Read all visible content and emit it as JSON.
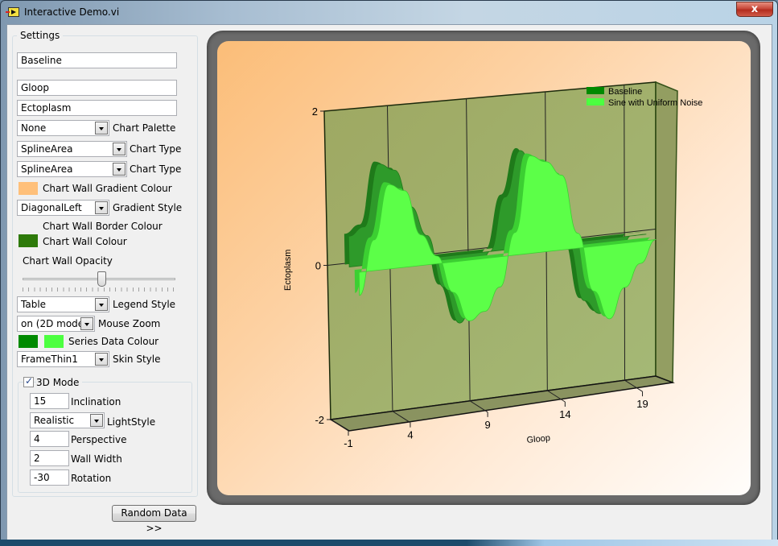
{
  "window": {
    "title": "Interactive Demo.vi",
    "close_label": "x"
  },
  "settings": {
    "group_title": "Settings",
    "series1_name": "Baseline",
    "x_axis_title": "Gloop",
    "y_axis_title": "Ectoplasm",
    "chart_palette": {
      "value": "None",
      "label": "Chart Palette"
    },
    "chart_type_1": {
      "value": "SplineArea",
      "label": "Chart Type"
    },
    "chart_type_2": {
      "value": "SplineArea",
      "label": "Chart Type"
    },
    "wall_gradient_colour": {
      "label": "Chart Wall Gradient Colour",
      "color": "#ffc07a"
    },
    "gradient_style": {
      "value": "DiagonalLeft",
      "label": "Gradient Style"
    },
    "wall_border_colour": {
      "label": "Chart Wall Border Colour"
    },
    "wall_colour": {
      "label": "Chart Wall Colour",
      "color": "#2e7a0a"
    },
    "wall_opacity": {
      "label": "Chart Wall Opacity",
      "value_fraction": 0.5
    },
    "legend_style": {
      "value": "Table",
      "label": "Legend Style"
    },
    "mouse_zoom": {
      "value": "on (2D mode",
      "label": "Mouse Zoom"
    },
    "series_colour": {
      "label": "Series Data Colour",
      "color1": "#008a00",
      "color2": "#4cff40"
    },
    "skin_style": {
      "value": "FrameThin1",
      "label": "Skin Style"
    },
    "mode3d": {
      "label": "3D Mode",
      "checked": true,
      "inclination": {
        "value": "15",
        "label": "Inclination"
      },
      "light_style": {
        "value": "Realistic",
        "label": "LightStyle"
      },
      "perspective": {
        "value": "4",
        "label": "Perspective"
      },
      "wall_width": {
        "value": "2",
        "label": "Wall Width"
      },
      "rotation": {
        "value": "-30",
        "label": "Rotation"
      }
    }
  },
  "random_button": "Random Data >>",
  "chart_data": {
    "type": "area",
    "subtype": "3d-spline-area",
    "xlabel": "Gloop",
    "ylabel": "Ectoplasm",
    "x_ticks": [
      "-1",
      "4",
      "9",
      "14",
      "19"
    ],
    "y_ticks": [
      "-2",
      "0",
      "2"
    ],
    "xlim": [
      -1,
      20
    ],
    "ylim": [
      -2,
      2
    ],
    "legend": {
      "placement": "top-right",
      "entries": [
        "Baseline",
        "Sine with Uniform Noise"
      ]
    },
    "series": [
      {
        "name": "Baseline",
        "color": "#2e9a2a",
        "x": [
          0,
          1,
          2,
          3,
          4,
          5,
          6,
          7,
          8,
          9,
          10,
          11,
          12,
          13,
          14,
          15,
          16,
          17,
          18,
          19
        ],
        "values": [
          0.4,
          0.5,
          1.3,
          1.2,
          0.7,
          0.3,
          -0.4,
          -0.9,
          -0.6,
          0,
          0.7,
          1.3,
          0.9,
          0.4,
          0,
          -0.8,
          -1.0,
          -0.6,
          0,
          0
        ]
      },
      {
        "name": "Sine with Uniform Noise",
        "color": "#5cff48",
        "x": [
          0,
          1,
          2,
          3,
          4,
          5,
          6,
          7,
          8,
          9,
          10,
          11,
          12,
          13,
          14,
          15,
          16,
          17,
          18,
          19
        ],
        "values": [
          -0.3,
          0.4,
          1.1,
          1.0,
          0.4,
          0.1,
          -0.4,
          -0.8,
          -0.7,
          -0.4,
          0.3,
          1.3,
          1.2,
          1.0,
          0.2,
          -0.6,
          -1.0,
          -0.6,
          -0.3,
          0
        ]
      }
    ]
  }
}
